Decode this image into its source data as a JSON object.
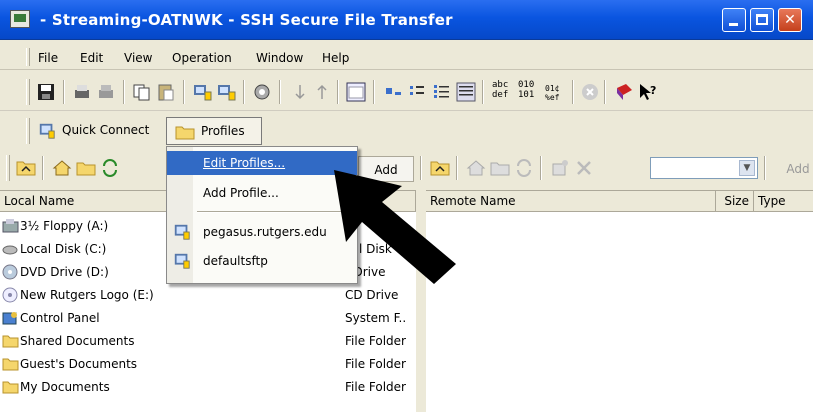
{
  "window": {
    "title": " - Streaming-OATNWK - SSH Secure File Transfer"
  },
  "menubar": [
    "File",
    "Edit",
    "View",
    "Operation",
    "Window",
    "Help"
  ],
  "toolbar2": {
    "quick_connect": "Quick Connect",
    "profiles": "Profiles"
  },
  "profiles_menu": {
    "edit": "Edit Profiles...",
    "add": "Add Profile...",
    "profiles": [
      "pegasus.rutgers.edu",
      "defaultsftp"
    ]
  },
  "left_pane": {
    "add_label": "Add",
    "header_name": "Local Name",
    "rows": [
      {
        "name": "3½ Floppy (A:)",
        "type": ""
      },
      {
        "name": "Local Disk (C:)",
        "type": "cal Disk"
      },
      {
        "name": "DVD Drive (D:)",
        "type": ") Drive"
      },
      {
        "name": "New Rutgers Logo (E:)",
        "type": "CD Drive"
      },
      {
        "name": "Control Panel",
        "type": "System F.."
      },
      {
        "name": "Shared Documents",
        "type": "File Folder"
      },
      {
        "name": "Guest's Documents",
        "type": "File Folder"
      },
      {
        "name": "My Documents",
        "type": "File Folder"
      }
    ]
  },
  "right_pane": {
    "add_label": "Add",
    "header_name": "Remote Name",
    "header_size": "Size",
    "header_type": "Type"
  },
  "toolbar1_text": {
    "abc": "abc\ndef",
    "bin": "010\n101"
  }
}
